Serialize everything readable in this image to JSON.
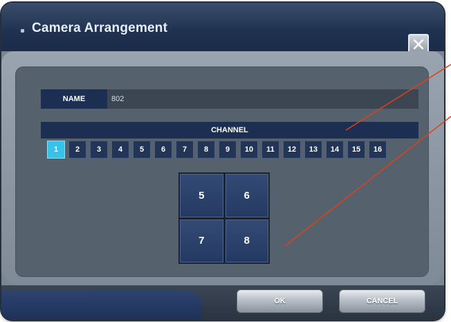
{
  "window": {
    "title": "Camera Arrangement",
    "close_icon": "close-icon"
  },
  "name_field": {
    "label": "NAME",
    "value": "802"
  },
  "channel": {
    "header": "CHANNEL",
    "buttons": [
      "1",
      "2",
      "3",
      "4",
      "5",
      "6",
      "7",
      "8",
      "9",
      "10",
      "11",
      "12",
      "13",
      "14",
      "15",
      "16"
    ],
    "selected": "1"
  },
  "layout_grid": {
    "cells": [
      "5",
      "6",
      "7",
      "8"
    ]
  },
  "footer": {
    "ok_label": "OK",
    "cancel_label": "CANCEL"
  },
  "colors": {
    "accent": "#36c2ea",
    "panel_blue": "#1c2e52",
    "annotation_line": "#e0401a"
  }
}
